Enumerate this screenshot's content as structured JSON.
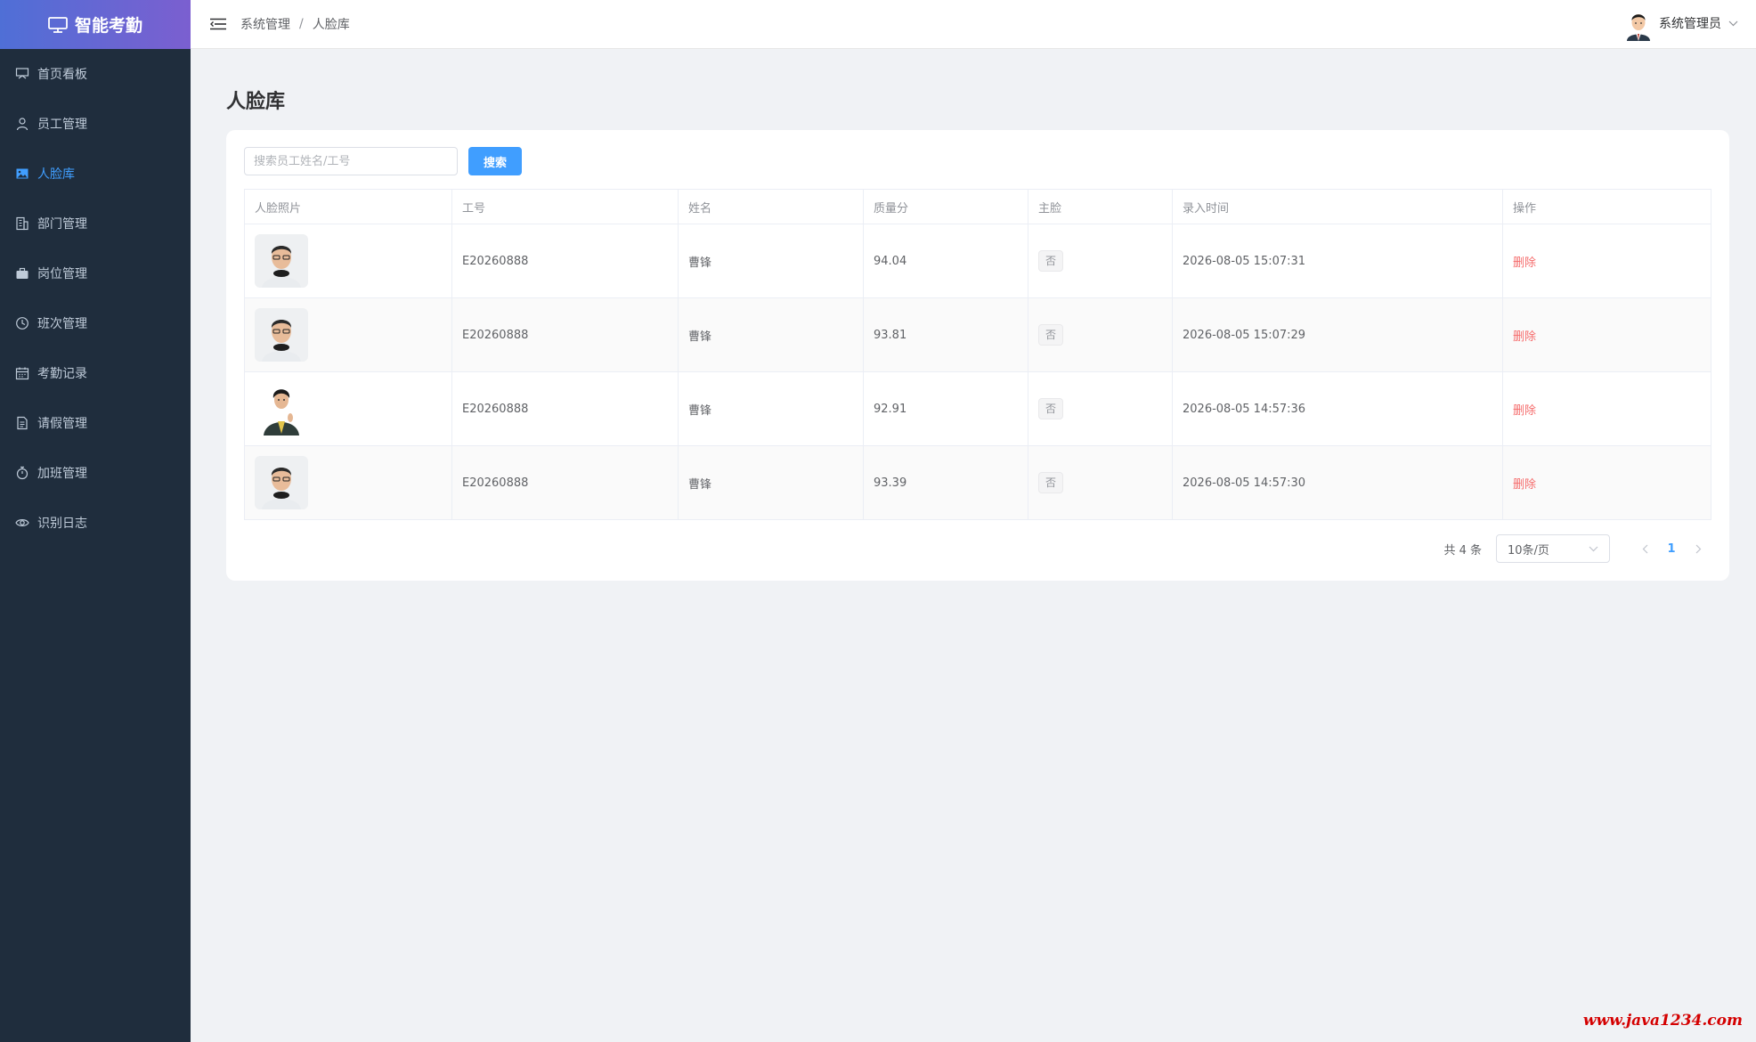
{
  "app": {
    "name": "智能考勤"
  },
  "sidebar": {
    "items": [
      {
        "label": "首页看板",
        "icon": "dashboard-icon",
        "active": false
      },
      {
        "label": "员工管理",
        "icon": "user-icon",
        "active": false
      },
      {
        "label": "人脸库",
        "icon": "picture-icon",
        "active": true
      },
      {
        "label": "部门管理",
        "icon": "office-building-icon",
        "active": false
      },
      {
        "label": "岗位管理",
        "icon": "briefcase-icon",
        "active": false
      },
      {
        "label": "班次管理",
        "icon": "clock-icon",
        "active": false
      },
      {
        "label": "考勤记录",
        "icon": "calendar-icon",
        "active": false
      },
      {
        "label": "请假管理",
        "icon": "document-icon",
        "active": false
      },
      {
        "label": "加班管理",
        "icon": "timer-icon",
        "active": false
      },
      {
        "label": "识别日志",
        "icon": "eye-icon",
        "active": false
      }
    ]
  },
  "header": {
    "breadcrumb": [
      "系统管理",
      "人脸库"
    ],
    "breadcrumb_separator": "/",
    "user_name": "系统管理员"
  },
  "page": {
    "title": "人脸库",
    "search_placeholder": "搜索员工姓名/工号",
    "search_button": "搜索"
  },
  "table": {
    "columns": [
      "人脸照片",
      "工号",
      "姓名",
      "质量分",
      "主脸",
      "录入时间",
      "操作"
    ],
    "rows": [
      {
        "photo": "portrait-glasses",
        "emp_no": "E20260888",
        "name": "曹锋",
        "score": "94.04",
        "primary": "否",
        "time": "2026-08-05 15:07:31",
        "action": "删除"
      },
      {
        "photo": "portrait-glasses",
        "emp_no": "E20260888",
        "name": "曹锋",
        "score": "93.81",
        "primary": "否",
        "time": "2026-08-05 15:07:29",
        "action": "删除"
      },
      {
        "photo": "portrait-suit",
        "emp_no": "E20260888",
        "name": "曹锋",
        "score": "92.91",
        "primary": "否",
        "time": "2026-08-05 14:57:36",
        "action": "删除"
      },
      {
        "photo": "portrait-glasses",
        "emp_no": "E20260888",
        "name": "曹锋",
        "score": "93.39",
        "primary": "否",
        "time": "2026-08-05 14:57:30",
        "action": "删除"
      }
    ]
  },
  "pagination": {
    "total_text": "共 4 条",
    "page_size": "10条/页",
    "current_page": "1"
  },
  "watermark": "www.java1234.com",
  "colors": {
    "primary": "#409eff",
    "sidebar_bg": "#1f2d3d",
    "danger": "#f56c6c"
  }
}
